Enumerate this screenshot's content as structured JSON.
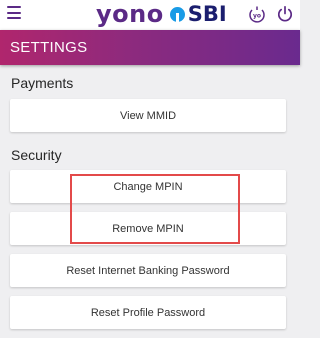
{
  "app": {
    "logo_left": "yono",
    "logo_right": "SBI"
  },
  "topbar": {
    "menu_icon": "hamburger-menu-icon",
    "yono_pay_icon": "yono-pay-icon",
    "power_icon": "power-icon"
  },
  "header": {
    "title": "SETTINGS"
  },
  "sections": {
    "payments": {
      "title": "Payments",
      "items": [
        {
          "label": "View MMID"
        }
      ]
    },
    "security": {
      "title": "Security",
      "items": [
        {
          "label": "Change MPIN"
        },
        {
          "label": "Remove MPIN"
        },
        {
          "label": "Reset Internet Banking Password"
        },
        {
          "label": "Reset Profile Password"
        }
      ]
    }
  },
  "colors": {
    "brand_purple": "#5b2a86",
    "header_gradient_start": "#b0266d",
    "header_gradient_end": "#6a2a8e",
    "highlight_red": "#e34a4a",
    "background": "#efeff1"
  }
}
